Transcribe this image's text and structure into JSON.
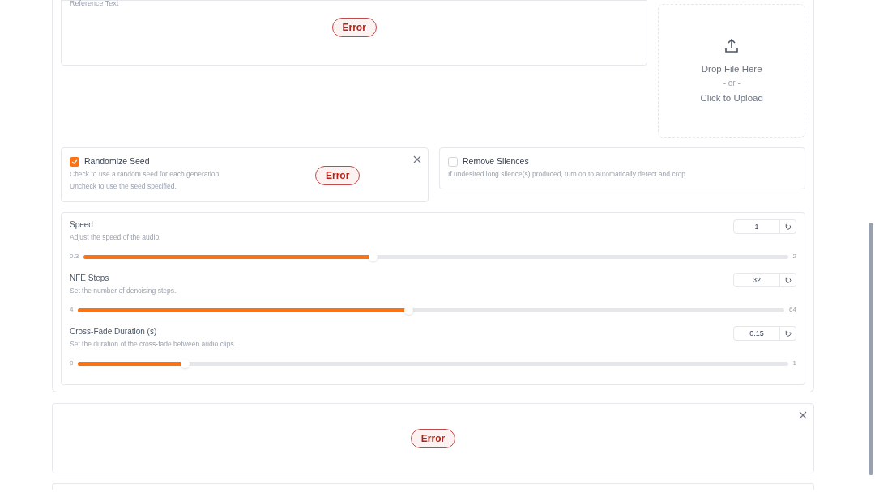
{
  "reference_text": {
    "label": "Reference Text",
    "error": "Error"
  },
  "upload": {
    "drop": "Drop File Here",
    "or": "- or -",
    "click": "Click to Upload"
  },
  "options": [
    {
      "label": "Randomize Seed",
      "checked": true,
      "info": [
        "Check to use a random seed for each generation.",
        "Uncheck to use the seed specified."
      ],
      "error": "Error"
    },
    {
      "label": "Remove Silences",
      "checked": false,
      "info": [
        "If undesired long silence(s) produced, turn on to automatically detect and crop."
      ]
    }
  ],
  "sliders": [
    {
      "label": "Speed",
      "info": "Adjust the speed of the audio.",
      "value": "1",
      "min": "0.3",
      "max": "2",
      "level": 0.41
    },
    {
      "label": "NFE Steps",
      "info": "Set the number of denoising steps.",
      "value": "32",
      "min": "4",
      "max": "64",
      "level": 0.467
    },
    {
      "label": "Cross-Fade Duration (s)",
      "info": "Set the duration of the cross-fade between audio clips.",
      "value": "0.15",
      "min": "0",
      "max": "1",
      "level": 0.15
    }
  ],
  "output_panel": {
    "error": "Error"
  }
}
